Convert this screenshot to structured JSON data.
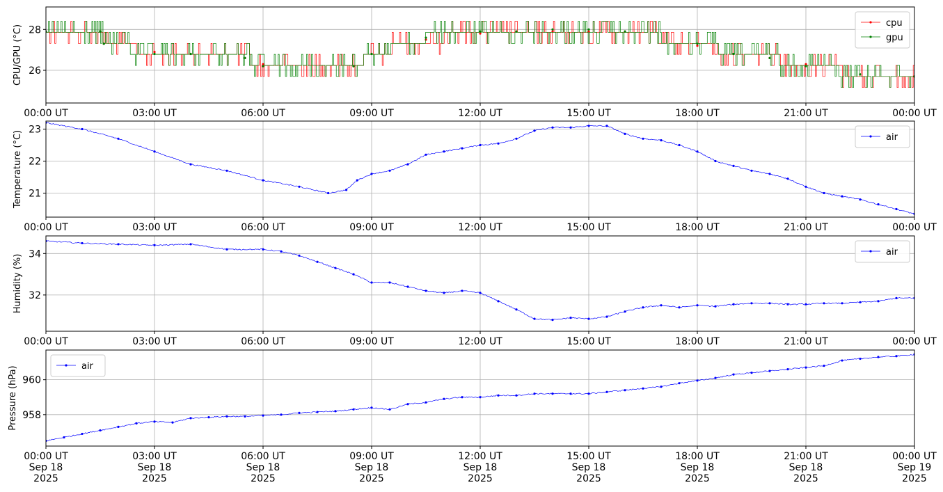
{
  "chart_data": [
    {
      "type": "line",
      "ylabel": "CPU/GPU (°C)",
      "ylim": [
        24.4,
        29.1
      ],
      "yticks": [
        26,
        28
      ],
      "grid": true,
      "legend_position": "top-right",
      "x_range": [
        "2025-09-18 00:00",
        "2025-09-19 00:00"
      ],
      "xtick_labels": [
        "00:00 UT",
        "03:00 UT",
        "06:00 UT",
        "09:00 UT",
        "12:00 UT",
        "15:00 UT",
        "18:00 UT",
        "21:00 UT",
        "00:00 UT"
      ],
      "series": [
        {
          "name": "cpu",
          "color": "#ff0000",
          "x_hours": [
            0,
            1.5,
            1.6,
            3.0,
            4.0,
            5.5,
            6.0,
            8.5,
            9.0,
            10.5,
            12.0,
            13.0,
            14.0,
            15.0,
            16.0,
            18.0,
            19.0,
            20.0,
            21.0,
            22.5,
            24
          ],
          "values": [
            27.9,
            27.9,
            27.3,
            26.9,
            26.8,
            26.6,
            26.3,
            26.2,
            26.8,
            27.5,
            27.8,
            27.9,
            27.9,
            27.9,
            27.9,
            27.2,
            26.8,
            26.6,
            26.3,
            25.8,
            25.7
          ]
        },
        {
          "name": "gpu",
          "color": "#008000",
          "x_hours": [
            0,
            1.5,
            1.6,
            3.0,
            4.0,
            5.5,
            6.0,
            8.5,
            9.0,
            10.5,
            12.0,
            13.0,
            14.0,
            15.0,
            16.0,
            18.0,
            19.0,
            20.0,
            21.0,
            22.5,
            24
          ],
          "values": [
            27.9,
            27.9,
            27.3,
            26.8,
            26.8,
            26.6,
            26.2,
            26.2,
            26.8,
            27.6,
            27.9,
            27.9,
            28.0,
            28.0,
            27.9,
            27.3,
            26.8,
            26.6,
            26.2,
            25.8,
            25.7
          ]
        }
      ]
    },
    {
      "type": "line",
      "ylabel": "Temperature (°C)",
      "ylim": [
        20.25,
        23.25
      ],
      "yticks": [
        21,
        22,
        23
      ],
      "grid": true,
      "legend_position": "top-right",
      "x_range": [
        "2025-09-18 00:00",
        "2025-09-19 00:00"
      ],
      "xtick_labels": [
        "00:00 UT",
        "03:00 UT",
        "06:00 UT",
        "09:00 UT",
        "12:00 UT",
        "15:00 UT",
        "18:00 UT",
        "21:00 UT",
        "00:00 UT"
      ],
      "series": [
        {
          "name": "air",
          "color": "#0000ff",
          "x_hours": [
            0,
            1,
            2,
            3,
            4,
            5,
            6,
            7,
            7.8,
            8.3,
            8.6,
            9.0,
            9.5,
            10.0,
            10.5,
            11.0,
            11.5,
            12.0,
            12.5,
            13.0,
            13.5,
            14.0,
            14.5,
            15.0,
            15.5,
            16.0,
            16.5,
            17.0,
            17.5,
            18.0,
            18.5,
            19.0,
            19.5,
            20.0,
            20.5,
            21.0,
            21.5,
            22.0,
            22.5,
            23.0,
            23.5,
            24
          ],
          "values": [
            23.2,
            23.0,
            22.7,
            22.3,
            21.9,
            21.7,
            21.4,
            21.2,
            21.0,
            21.1,
            21.4,
            21.6,
            21.7,
            21.9,
            22.2,
            22.3,
            22.4,
            22.5,
            22.55,
            22.7,
            22.95,
            23.05,
            23.05,
            23.1,
            23.1,
            22.85,
            22.7,
            22.65,
            22.5,
            22.3,
            22.0,
            21.85,
            21.7,
            21.6,
            21.45,
            21.2,
            21.0,
            20.9,
            20.8,
            20.65,
            20.5,
            20.35
          ]
        }
      ]
    },
    {
      "type": "line",
      "ylabel": "Humidity (%)",
      "ylim": [
        30.25,
        34.85
      ],
      "yticks": [
        32,
        34
      ],
      "grid": true,
      "legend_position": "top-right",
      "x_range": [
        "2025-09-18 00:00",
        "2025-09-19 00:00"
      ],
      "xtick_labels": [
        "00:00 UT",
        "03:00 UT",
        "06:00 UT",
        "09:00 UT",
        "12:00 UT",
        "15:00 UT",
        "18:00 UT",
        "21:00 UT",
        "00:00 UT"
      ],
      "series": [
        {
          "name": "air",
          "color": "#0000ff",
          "x_hours": [
            0,
            1,
            2,
            3,
            4,
            5,
            6,
            6.5,
            7.0,
            7.5,
            8.0,
            8.5,
            9.0,
            9.5,
            10.0,
            10.5,
            11.0,
            11.5,
            12.0,
            12.5,
            13.0,
            13.5,
            14.0,
            14.5,
            15.0,
            15.5,
            16.0,
            16.5,
            17.0,
            17.5,
            18.0,
            18.5,
            19.0,
            19.5,
            20.0,
            20.5,
            21.0,
            21.5,
            22.0,
            22.5,
            23.0,
            23.5,
            24
          ],
          "values": [
            34.6,
            34.5,
            34.45,
            34.4,
            34.45,
            34.2,
            34.2,
            34.1,
            33.9,
            33.6,
            33.3,
            33.0,
            32.6,
            32.6,
            32.4,
            32.2,
            32.1,
            32.2,
            32.1,
            31.7,
            31.3,
            30.85,
            30.8,
            30.9,
            30.85,
            30.95,
            31.2,
            31.4,
            31.5,
            31.4,
            31.5,
            31.45,
            31.55,
            31.6,
            31.6,
            31.55,
            31.55,
            31.6,
            31.6,
            31.65,
            31.7,
            31.85,
            31.85
          ]
        }
      ]
    },
    {
      "type": "line",
      "ylabel": "Pressure (hPa)",
      "ylim": [
        956.2,
        961.7
      ],
      "yticks": [
        958,
        960
      ],
      "grid": true,
      "legend_position": "top-left",
      "x_range": [
        "2025-09-18 00:00",
        "2025-09-19 00:00"
      ],
      "xtick_labels": [
        "00:00 UT\nSep 18\n2025",
        "03:00 UT\nSep 18\n2025",
        "06:00 UT\nSep 18\n2025",
        "09:00 UT\nSep 18\n2025",
        "12:00 UT\nSep 18\n2025",
        "15:00 UT\nSep 18\n2025",
        "18:00 UT\nSep 18\n2025",
        "21:00 UT\nSep 18\n2025",
        "00:00 UT\nSep 19\n2025"
      ],
      "series": [
        {
          "name": "air",
          "color": "#0000ff",
          "x_hours": [
            0,
            0.5,
            1,
            1.5,
            2,
            2.5,
            3,
            3.5,
            4,
            4.5,
            5,
            5.5,
            6,
            6.5,
            7,
            7.5,
            8,
            8.5,
            9,
            9.5,
            10,
            10.5,
            11,
            11.5,
            12,
            12.5,
            13,
            13.5,
            14,
            14.5,
            15,
            15.5,
            16,
            16.5,
            17,
            17.5,
            18,
            18.5,
            19,
            19.5,
            20,
            20.5,
            21,
            21.5,
            22,
            22.5,
            23,
            23.5,
            24
          ],
          "values": [
            956.5,
            956.7,
            956.9,
            957.1,
            957.3,
            957.5,
            957.6,
            957.55,
            957.8,
            957.85,
            957.9,
            957.9,
            957.95,
            958.0,
            958.1,
            958.15,
            958.2,
            958.3,
            958.4,
            958.3,
            958.6,
            958.7,
            958.9,
            959.0,
            959.0,
            959.1,
            959.1,
            959.2,
            959.2,
            959.2,
            959.2,
            959.3,
            959.4,
            959.5,
            959.6,
            959.8,
            959.95,
            960.1,
            960.3,
            960.4,
            960.5,
            960.6,
            960.7,
            960.8,
            961.1,
            961.2,
            961.3,
            961.35,
            961.45
          ]
        }
      ]
    }
  ]
}
